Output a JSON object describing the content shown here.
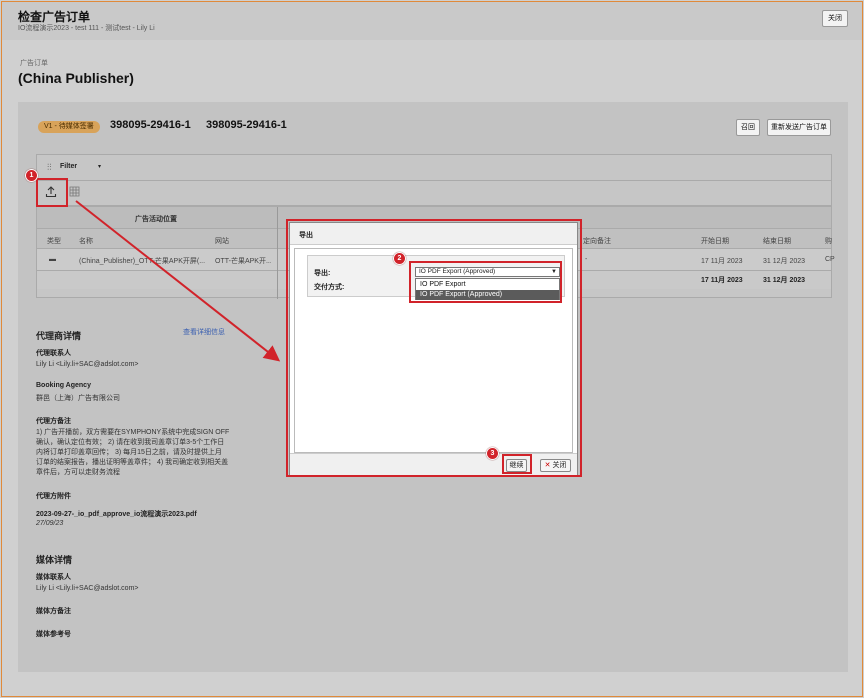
{
  "window": {
    "title": "检查广告订单",
    "subtitle": "IO流程演示2023 - test 111 - 测试test - Lily Li",
    "close_label": "关闭"
  },
  "breadcrumb": "广告订单",
  "publisher_title": "(China Publisher)",
  "order": {
    "status_badge": "V1 - 待媒体签署",
    "number_1": "398095-29416-1",
    "number_2": "398095-29416-1",
    "recall_label": "召回",
    "resend_label": "重新发送广告订单"
  },
  "toolbar": {
    "filter_label": "Filter",
    "filter_caret": "▾"
  },
  "table": {
    "group_header": "广告活动位置",
    "columns": [
      "类型",
      "名称",
      "网站",
      "定向备注",
      "开始日期",
      "结束日期",
      "购"
    ],
    "row": {
      "name": "(China_Publisher)_OTT-芒果APK开屏(...",
      "site": "OTT-芒果APK开...",
      "targeting": "-",
      "start": "17 11月 2023",
      "end": "31 12月 2023",
      "buy": "CP"
    },
    "total": {
      "start": "17 11月 2023",
      "end": "31 12月 2023"
    }
  },
  "agency": {
    "section_title": "代理商详情",
    "details_link": "查看详细信息",
    "contact_label": "代理联系人",
    "contact_value": "Lily Li <Lily.li+SAC@adslot.com>",
    "booking_label": "Booking Agency",
    "booking_value": "群邑（上海）广告有限公司",
    "notes_label": "代理方备注",
    "notes_lines": [
      "1) 广告开播前，双方需要在SYMPHONY系统中完成SIGN OFF",
      "确认，确认定位有效；  2) 请在收到我司盖章订单3-5个工作日",
      "内将订单打印盖章回传；  3) 每月15日之前，请及时提供上月",
      "订单的结案报告，播出证明等盖章件；  4) 我司确定收到相关盖",
      "章件后，方可以走财务流程"
    ],
    "attachment_label": "代理方附件",
    "attachment_name": "2023-09-27-_io_pdf_approve_io流程演示2023.pdf",
    "attachment_date": "27/09/23"
  },
  "media": {
    "section_title": "媒体详情",
    "contact_label": "媒体联系人",
    "contact_value": "Lily Li <Lily.li+SAC@adslot.com>",
    "notes_label": "媒体方备注",
    "ref_label": "媒体参考号"
  },
  "export_dialog": {
    "title": "导出",
    "export_label": "导出:",
    "delivery_label": "交付方式:",
    "selected_value": "IO PDF Export (Approved)",
    "options": [
      "IO PDF Export",
      "IO PDF Export (Approved)"
    ],
    "continue_label": "继续",
    "close_label": "关闭"
  },
  "annotations": {
    "markers": [
      "1",
      "2",
      "3"
    ],
    "color": "#d1232a"
  },
  "colors": {
    "badge": "#d8a35a",
    "link": "#3a5fb0",
    "frame_border": "#e08a3a"
  }
}
